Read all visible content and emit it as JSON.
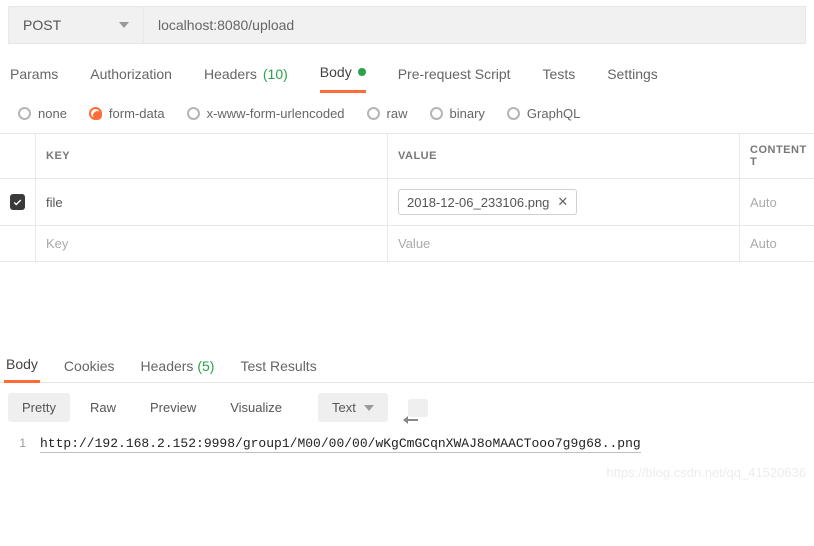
{
  "request": {
    "method": "POST",
    "url": "localhost:8080/upload"
  },
  "tabs": {
    "params": "Params",
    "authorization": "Authorization",
    "headers_label": "Headers",
    "headers_count": "(10)",
    "body": "Body",
    "prerequest": "Pre-request Script",
    "tests": "Tests",
    "settings": "Settings"
  },
  "body_types": {
    "none": "none",
    "form_data": "form-data",
    "x_www": "x-www-form-urlencoded",
    "raw": "raw",
    "binary": "binary",
    "graphql": "GraphQL"
  },
  "kv": {
    "header_key": "KEY",
    "header_value": "VALUE",
    "header_content": "CONTENT T",
    "row0_key": "file",
    "row0_file": "2018-12-06_233106.png",
    "row0_content": "Auto",
    "row_ph_key": "Key",
    "row_ph_value": "Value",
    "row_ph_content": "Auto"
  },
  "resp_tabs": {
    "body": "Body",
    "cookies": "Cookies",
    "headers_label": "Headers",
    "headers_count": "(5)",
    "test_results": "Test Results"
  },
  "resp_tools": {
    "pretty": "Pretty",
    "raw": "Raw",
    "preview": "Preview",
    "visualize": "Visualize",
    "mode": "Text"
  },
  "response": {
    "line_no": "1",
    "line_1": "http://192.168.2.152:9998/group1/M00/00/00/wKgCmGCqnXWAJ8oMAACTooo7g9g68..png"
  },
  "watermark": "https://blog.csdn.net/qq_41520636"
}
